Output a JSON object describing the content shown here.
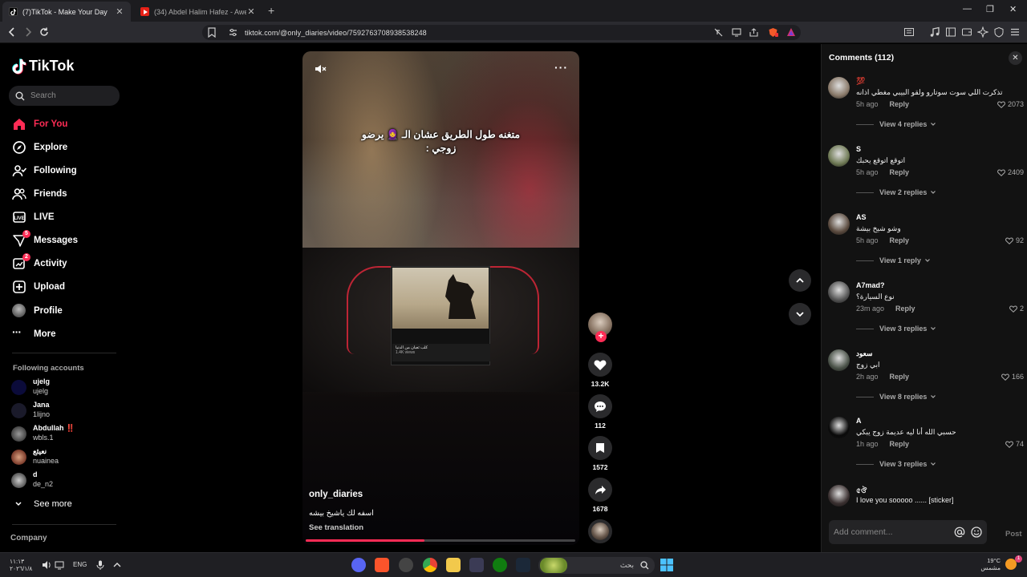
{
  "browser": {
    "tabs": [
      {
        "title": "(7)TikTok - Make Your Day",
        "active": true
      },
      {
        "title": "(34) Abdel Halim Hafez - Awel Mara",
        "active": false
      }
    ],
    "url": "tiktok.com/@only_diaries/video/7592763708938538248"
  },
  "sidebar": {
    "logo": "TikTok",
    "search_placeholder": "Search",
    "nav": [
      {
        "label": "For You",
        "icon": "home-icon",
        "active": true
      },
      {
        "label": "Explore",
        "icon": "compass-icon"
      },
      {
        "label": "Following",
        "icon": "following-icon"
      },
      {
        "label": "Friends",
        "icon": "friends-icon"
      },
      {
        "label": "LIVE",
        "icon": "live-icon"
      },
      {
        "label": "Messages",
        "icon": "messages-icon",
        "badge": "5"
      },
      {
        "label": "Activity",
        "icon": "activity-icon",
        "badge": "2"
      },
      {
        "label": "Upload",
        "icon": "upload-icon"
      },
      {
        "label": "Profile",
        "icon": "profile-icon"
      },
      {
        "label": "More",
        "icon": "more-icon"
      }
    ],
    "following_title": "Following accounts",
    "accounts": [
      {
        "name": "ujelg",
        "handle": "ujelg"
      },
      {
        "name": "Jana",
        "handle": "1lijno"
      },
      {
        "name": "Abdullah ‼️",
        "handle": "wbls.1"
      },
      {
        "name": "نعيثع",
        "handle": "nuainea"
      },
      {
        "name": "d",
        "handle": "de_n2"
      }
    ],
    "see_more": "See more",
    "company": "Company"
  },
  "video": {
    "overlay_text": "متغنه طول الطريق عشان الـ 🧕 يرضو زوجي :",
    "screen_caption": "كلب ثعبان من الدنيا",
    "screen_sub": "1.4K views",
    "author": "only_diaries",
    "caption": "اسفه لك ياشيخ بيشه",
    "see_translation": "See translation",
    "progress": 0.44
  },
  "actions": {
    "likes": "13.2K",
    "comments": "112",
    "saves": "1572",
    "shares": "1678"
  },
  "comments_panel": {
    "title": "Comments (112)",
    "input_placeholder": "Add comment...",
    "post_label": "Post",
    "reply_label": "Reply",
    "comments": [
      {
        "user": "💯",
        "text": "تذكرت اللي سوت سوتارو ولقو البيبي مغطي اذانه",
        "time": "5h ago",
        "likes": "2073",
        "replies": "View 4 replies",
        "av": "#8a7a6a"
      },
      {
        "user": "S",
        "text": "اتوقع اتوقع يحبك",
        "time": "5h ago",
        "likes": "2409",
        "replies": "View 2 replies",
        "av": "#6f7a55"
      },
      {
        "user": "AS",
        "text": "وشو شيخ بيشة",
        "time": "5h ago",
        "likes": "92",
        "replies": "View 1 reply",
        "av": "#5a4a3e"
      },
      {
        "user": "A7mad?",
        "text": "نوع السيارة؟",
        "time": "23m ago",
        "likes": "2",
        "replies": "View 3 replies",
        "av": "#555"
      },
      {
        "user": "سعود",
        "text": "ابي زوج",
        "time": "2h ago",
        "likes": "166",
        "replies": "View 8 replies",
        "av": "#4a5248"
      },
      {
        "user": "A",
        "text": "حسبي الله أنا ليه عديمة زوج يبكي",
        "time": "1h ago",
        "likes": "74",
        "replies": "View 3 replies",
        "av": "#0a0a0a"
      },
      {
        "user": "৫ঔ",
        "text": "I love you sooooo ...... [sticker]",
        "time": "",
        "likes": "",
        "replies": "",
        "av": "#3a3030"
      }
    ]
  },
  "taskbar": {
    "time": "١١:١٣",
    "date": "٢٠٢٦/١/٨",
    "lang": "ENG",
    "search_text": "بحث",
    "temp": "19°C",
    "weather": "مشمس"
  }
}
